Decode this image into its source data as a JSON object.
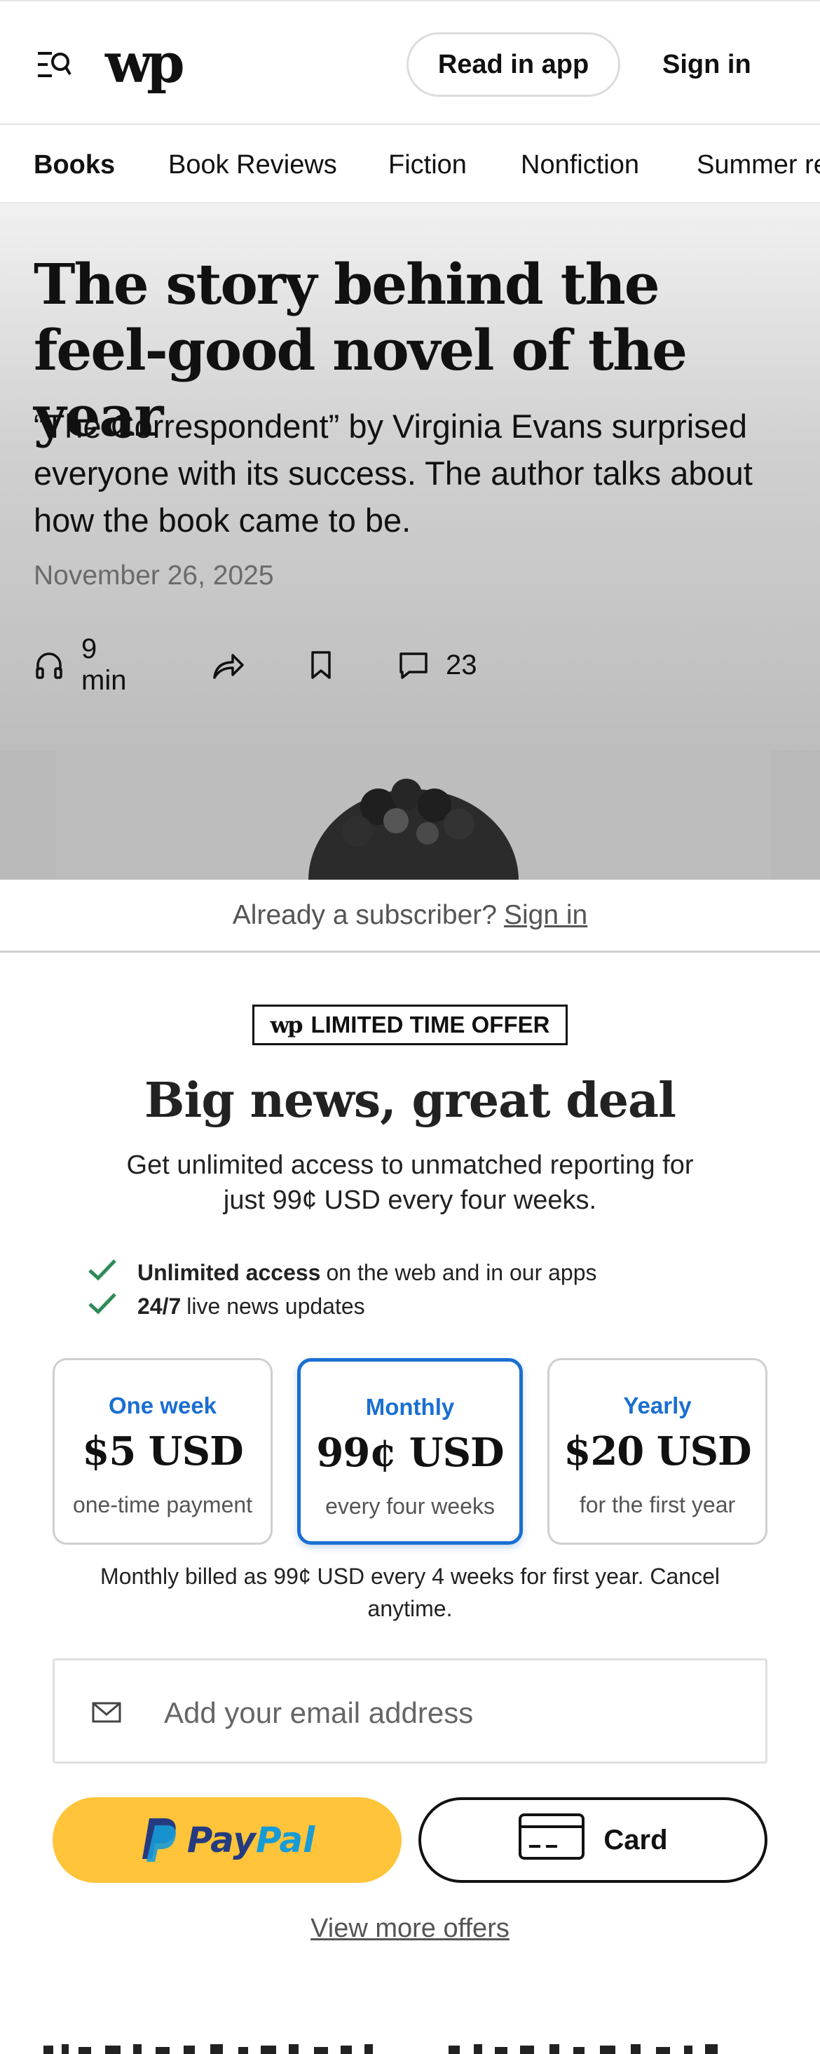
{
  "header": {
    "logo_text": "wp",
    "read_in_app_label": "Read in app",
    "sign_in_label": "Sign in"
  },
  "section_nav": {
    "items": [
      {
        "label": "Books",
        "active": true
      },
      {
        "label": "Book Reviews",
        "active": false
      },
      {
        "label": "Fiction",
        "active": false
      },
      {
        "label": "Nonfiction",
        "active": false
      },
      {
        "label": "Summer reading",
        "active": false
      }
    ]
  },
  "article": {
    "headline": "The story behind the feel-good novel of the year",
    "dek": "“The Correspondent” by Virginia Evans surprised everyone with its success. The author talks about how the book came to be.",
    "date": "November 26, 2025",
    "listen_time": "9 min",
    "comment_count": "23"
  },
  "paywall": {
    "subscriber_prompt": "Already a subscriber?",
    "subscriber_sign_in": "Sign in",
    "badge_logo": "wp",
    "badge_text": "LIMITED TIME OFFER",
    "title": "Big news, great deal",
    "subtitle": "Get unlimited access to unmatched reporting for just 99¢ USD every four weeks.",
    "benefits": [
      {
        "bold": "Unlimited access",
        "text": "on the web and in our apps"
      },
      {
        "bold": "24/7",
        "text": "live news updates"
      }
    ],
    "plans": [
      {
        "name": "One week",
        "price": "$5 USD",
        "note": "one-time payment",
        "selected": false
      },
      {
        "name": "Monthly",
        "price": "99¢ USD",
        "note": "every four weeks",
        "selected": true
      },
      {
        "name": "Yearly",
        "price": "$20 USD",
        "note": "for the first year",
        "selected": false
      }
    ],
    "billing_note": "Monthly billed as 99¢ USD every 4 weeks for first year. Cancel anytime.",
    "email_placeholder": "Add your email address",
    "paypal_pay": "Pay",
    "paypal_pal": "Pal",
    "card_label": "Card",
    "more_offers": "View more offers"
  },
  "colors": {
    "accent_blue": "#1a6fd1",
    "paypal_yellow": "#ffc439",
    "check_green": "#2e8b57"
  }
}
